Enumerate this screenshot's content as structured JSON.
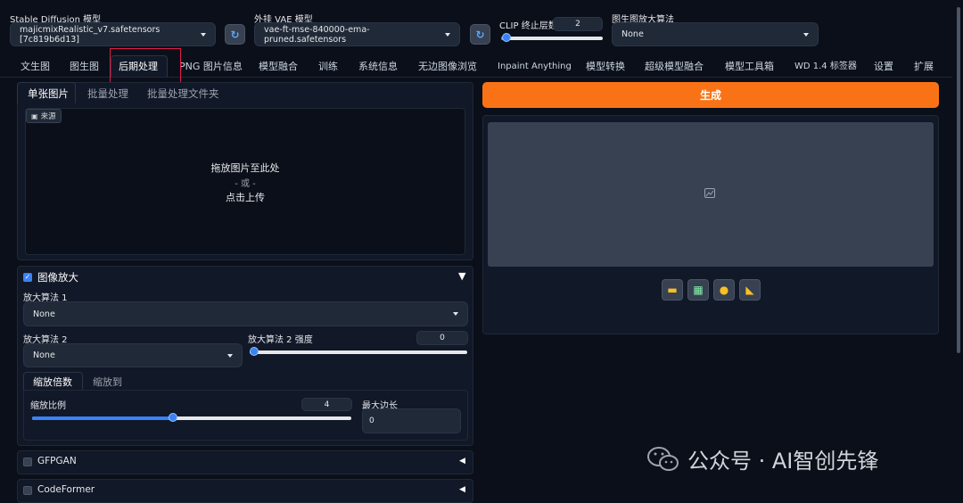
{
  "top": {
    "sd_model": {
      "label": "Stable Diffusion 模型",
      "value": "majicmixRealistic_v7.safetensors [7c819b6d13]"
    },
    "vae": {
      "label": "外挂 VAE 模型",
      "value": "vae-ft-mse-840000-ema-pruned.safetensors"
    },
    "clip": {
      "label": "CLIP 终止层数",
      "value": "2",
      "fraction": 0.05
    },
    "upscaler": {
      "label": "图生图放大算法",
      "value": "None"
    }
  },
  "tabs": [
    "文生图",
    "图生图",
    "后期处理",
    "PNG 图片信息",
    "模型融合",
    "训练",
    "系统信息",
    "无边图像浏览",
    "Inpaint Anything",
    "模型转换",
    "超级模型融合",
    "模型工具箱",
    "WD 1.4 标签器",
    "设置",
    "扩展"
  ],
  "subtabs": [
    "单张图片",
    "批量处理",
    "批量处理文件夹"
  ],
  "upload": {
    "source_label": "来源",
    "drop_text": "拖放图片至此处",
    "or_text": "- 或 -",
    "click_text": "点击上传"
  },
  "upscale": {
    "title": "图像放大",
    "upscaler1_label": "放大算法 1",
    "upscaler1_value": "None",
    "upscaler2_label": "放大算法 2",
    "upscaler2_value": "None",
    "strength_label": "放大算法 2 强度",
    "strength_value": "0",
    "strength_fraction": 0.0,
    "mode_tabs": [
      "缩放倍数",
      "缩放到"
    ],
    "ratio_label": "缩放比例",
    "ratio_value": "4",
    "ratio_fraction": 0.44,
    "max_side_label": "最大边长",
    "max_side_value": "0"
  },
  "sections": {
    "gfpgan": "GFPGAN",
    "codeformer": "CodeFormer"
  },
  "generate_label": "生成",
  "watermark": "公众号 · AI智创先锋",
  "colors": {
    "accent": "#3b82f6",
    "generate": "#f97316",
    "annotation": "#e11d48"
  }
}
